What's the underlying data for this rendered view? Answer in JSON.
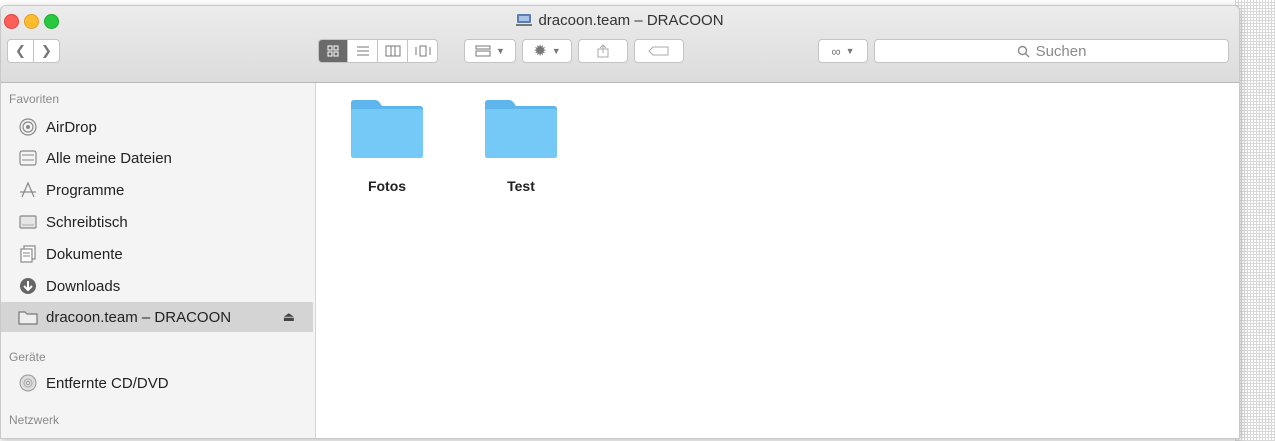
{
  "window": {
    "title": "dracoon.team – DRACOON"
  },
  "toolbar": {
    "search_placeholder": "Suchen"
  },
  "sidebar": {
    "favorites_heading": "Favoriten",
    "favorites": [
      {
        "label": "AirDrop",
        "icon": "airdrop-icon"
      },
      {
        "label": "Alle meine Dateien",
        "icon": "all-files-icon"
      },
      {
        "label": "Programme",
        "icon": "applications-icon"
      },
      {
        "label": "Schreibtisch",
        "icon": "desktop-icon"
      },
      {
        "label": "Dokumente",
        "icon": "documents-icon"
      },
      {
        "label": "Downloads",
        "icon": "downloads-icon"
      },
      {
        "label": "dracoon.team – DRACOON",
        "icon": "folder-icon",
        "selected": true
      }
    ],
    "devices_heading": "Geräte",
    "devices": [
      {
        "label": "Entfernte CD/DVD",
        "icon": "cd-dvd-icon"
      }
    ],
    "network_heading": "Netzwerk"
  },
  "content": {
    "folders": [
      {
        "name": "Fotos",
        "color": "#6cc4f5"
      },
      {
        "name": "Test",
        "color": "#6cc4f5"
      }
    ]
  },
  "colors": {
    "sidebar_selected": "#d4d4d4",
    "folder": "#6cc4f5"
  }
}
